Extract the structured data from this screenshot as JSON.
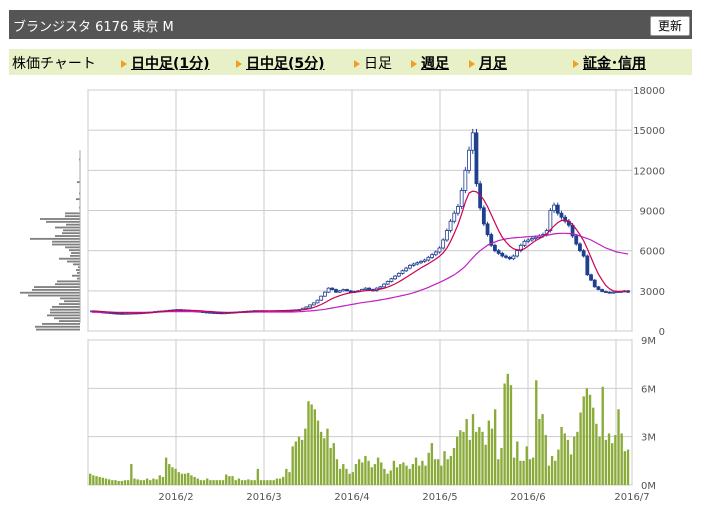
{
  "header": {
    "title": "ブランジスタ  6176  東京 M",
    "refresh_label": "更新"
  },
  "tabs": [
    {
      "label": "株価チャート",
      "link": false
    },
    {
      "label": "日中足(1分)",
      "link": true
    },
    {
      "label": "日中足(5分)",
      "link": true
    },
    {
      "label": "日足",
      "link": false
    },
    {
      "label": "週足",
      "link": true
    },
    {
      "label": "月足",
      "link": true
    },
    {
      "label": "証金･信用",
      "link": true
    }
  ],
  "chart_data": [
    {
      "type": "candlestick",
      "ylim": [
        0,
        18000
      ],
      "yticks": [
        "18000",
        "15000",
        "12000",
        "9000",
        "6000",
        "3000",
        "0"
      ],
      "x_labels": [
        "2016/2",
        "2016/3",
        "2016/4",
        "2016/5",
        "2016/6",
        "2016/7"
      ],
      "colors": {
        "up": "#ffffff",
        "down": "#1f3f8f",
        "ma_short": "#cc0055",
        "ma_long": "#c020c0",
        "volume": "#8aab3a",
        "profile": "#808080"
      },
      "close": [
        1500,
        1450,
        1420,
        1400,
        1380,
        1350,
        1330,
        1320,
        1310,
        1320,
        1330,
        1340,
        1350,
        1360,
        1380,
        1400,
        1420,
        1450,
        1480,
        1500,
        1520,
        1550,
        1580,
        1600,
        1580,
        1550,
        1520,
        1500,
        1480,
        1450,
        1420,
        1400,
        1380,
        1370,
        1360,
        1350,
        1360,
        1380,
        1400,
        1420,
        1440,
        1460,
        1480,
        1500,
        1520,
        1520,
        1510,
        1500,
        1500,
        1510,
        1520,
        1530,
        1540,
        1550,
        1560,
        1580,
        1600,
        1700,
        1800,
        1950,
        2100,
        2300,
        2600,
        2900,
        3200,
        3100,
        2900,
        3000,
        3100,
        3000,
        2900,
        2950,
        3000,
        3100,
        3200,
        3100,
        3000,
        3200,
        3300,
        3500,
        3700,
        3900,
        4100,
        4300,
        4500,
        4700,
        4900,
        5000,
        5100,
        5200,
        5300,
        5500,
        5700,
        5900,
        6200,
        6800,
        7500,
        8200,
        8800,
        9300,
        10500,
        12000,
        13500,
        14800,
        11000,
        9200,
        8000,
        7200,
        6400,
        6000,
        5800,
        5600,
        5500,
        5400,
        5600,
        6000,
        6400,
        6700,
        6800,
        6900,
        7000,
        7100,
        7200,
        7500,
        9000,
        9400,
        8800,
        8500,
        8200,
        7900,
        7100,
        6500,
        6000,
        5600,
        4200,
        3800,
        3300,
        3100,
        2950,
        2900,
        2850,
        2900,
        2950,
        2950,
        3000,
        2900
      ],
      "ma_short": [
        1500,
        1490,
        1470,
        1450,
        1430,
        1410,
        1390,
        1370,
        1360,
        1350,
        1345,
        1340,
        1340,
        1345,
        1355,
        1370,
        1385,
        1405,
        1425,
        1450,
        1475,
        1500,
        1525,
        1545,
        1555,
        1555,
        1550,
        1540,
        1530,
        1515,
        1495,
        1475,
        1455,
        1435,
        1415,
        1395,
        1385,
        1378,
        1378,
        1385,
        1395,
        1410,
        1425,
        1440,
        1460,
        1478,
        1492,
        1500,
        1505,
        1508,
        1512,
        1515,
        1518,
        1522,
        1528,
        1538,
        1550,
        1580,
        1620,
        1680,
        1760,
        1860,
        1980,
        2120,
        2280,
        2420,
        2540,
        2640,
        2730,
        2800,
        2850,
        2900,
        2940,
        2980,
        3010,
        3030,
        3050,
        3080,
        3120,
        3190,
        3280,
        3390,
        3520,
        3670,
        3830,
        4000,
        4180,
        4360,
        4540,
        4710,
        4870,
        5030,
        5200,
        5380,
        5580,
        5840,
        6200,
        6700,
        7300,
        7950,
        8750,
        9650,
        10300,
        10450,
        10400,
        10150,
        9800,
        9300,
        8700,
        8100,
        7500,
        7000,
        6650,
        6350,
        6150,
        6050,
        6050,
        6150,
        6350,
        6550,
        6750,
        6900,
        7050,
        7250,
        7550,
        7850,
        8100,
        8250,
        8300,
        8200,
        7950,
        7600,
        7200,
        6750,
        6150,
        5500,
        4850,
        4250,
        3800,
        3400,
        3150,
        3000,
        2950,
        2950,
        2950,
        2950
      ],
      "ma_long": [
        1400,
        1400,
        1400,
        1400,
        1400,
        1400,
        1400,
        1400,
        1400,
        1400,
        1400,
        1400,
        1400,
        1400,
        1400,
        1400,
        1400,
        1410,
        1420,
        1430,
        1440,
        1450,
        1450,
        1450,
        1450,
        1450,
        1450,
        1450,
        1450,
        1450,
        1450,
        1440,
        1430,
        1420,
        1410,
        1400,
        1400,
        1400,
        1400,
        1400,
        1400,
        1400,
        1400,
        1410,
        1420,
        1420,
        1420,
        1420,
        1420,
        1420,
        1420,
        1420,
        1420,
        1420,
        1420,
        1430,
        1440,
        1460,
        1480,
        1500,
        1520,
        1550,
        1580,
        1620,
        1670,
        1720,
        1770,
        1820,
        1870,
        1920,
        1970,
        2020,
        2070,
        2110,
        2150,
        2190,
        2230,
        2270,
        2320,
        2370,
        2420,
        2470,
        2530,
        2590,
        2650,
        2710,
        2780,
        2860,
        2950,
        3050,
        3150,
        3260,
        3380,
        3500,
        3630,
        3760,
        3900,
        4050,
        4200,
        4400,
        4600,
        4850,
        5150,
        5450,
        5750,
        6000,
        6200,
        6400,
        6550,
        6650,
        6750,
        6820,
        6880,
        6920,
        6950,
        6980,
        7000,
        7020,
        7040,
        7060,
        7080,
        7100,
        7120,
        7150,
        7200,
        7250,
        7280,
        7300,
        7300,
        7280,
        7250,
        7200,
        7100,
        7000,
        6900,
        6800,
        6650,
        6500,
        6350,
        6200,
        6100,
        6000,
        5900,
        5850,
        5800,
        5750
      ],
      "profile": [
        0,
        0,
        0,
        0,
        0,
        0,
        0,
        0,
        0,
        0,
        0,
        0,
        0,
        0,
        0,
        0,
        0,
        0,
        0,
        0,
        0,
        0,
        0,
        0,
        1,
        0,
        0,
        0,
        0,
        0,
        0,
        0,
        3,
        0,
        0,
        0,
        1,
        0,
        4,
        0,
        0,
        1,
        0,
        15,
        15,
        40,
        34,
        14,
        25,
        17,
        18,
        25,
        50,
        28,
        28,
        15,
        11,
        9,
        10,
        21,
        13,
        7,
        2,
        4,
        3,
        8,
        3,
        23,
        25,
        46,
        48,
        60,
        52,
        20,
        16,
        21,
        28,
        30,
        30,
        33,
        26,
        21,
        38,
        45,
        44
      ]
    },
    {
      "type": "bar",
      "ylim": [
        0,
        9000000
      ],
      "yticks": [
        "9M",
        "6M",
        "3M",
        "0M"
      ],
      "values": [
        700000,
        600000,
        550000,
        500000,
        450000,
        400000,
        350000,
        300000,
        300000,
        250000,
        250000,
        300000,
        300000,
        1300000,
        400000,
        350000,
        300000,
        300000,
        400000,
        300000,
        400000,
        350000,
        600000,
        500000,
        1700000,
        1300000,
        1100000,
        1000000,
        800000,
        700000,
        700000,
        750000,
        600000,
        500000,
        400000,
        300000,
        300000,
        400000,
        300000,
        300000,
        300000,
        300000,
        300000,
        650000,
        550000,
        550000,
        300000,
        400000,
        300000,
        300000,
        350000,
        300000,
        300000,
        1000000,
        300000,
        300000,
        300000,
        300000,
        300000,
        400000,
        400000,
        500000,
        1000000,
        800000,
        2400000,
        2700000,
        3000000,
        2800000,
        3500000,
        5200000,
        5000000,
        4700000,
        4000000,
        3300000,
        2900000,
        3500000,
        2300000,
        2600000,
        1600000,
        1000000,
        1300000,
        1000000,
        700000,
        800000,
        1300000,
        1600000,
        1400000,
        1800000,
        1500000,
        1100000,
        1300000,
        1700000,
        1400000,
        1000000,
        700000,
        900000,
        1500000,
        1100000,
        1300000,
        1400000,
        1200000,
        1000000,
        1300000,
        1700000,
        1200000,
        1500000,
        1200000,
        2000000,
        2600000,
        1600000,
        1600000,
        1200000,
        2100000,
        1600000,
        1800000,
        2300000,
        3000000,
        3400000,
        3300000,
        4100000,
        2800000,
        4400000,
        3300000,
        3600000,
        3300000,
        2500000,
        4000000,
        3500000,
        4700000,
        1600000,
        2300000,
        6300000,
        6900000,
        6200000,
        1700000,
        2700000,
        1500000,
        1500000,
        2400000,
        1600000,
        1700000,
        6500000,
        4100000,
        4400000,
        3100000,
        1200000,
        1800000,
        1500000,
        2200000,
        3600000,
        3200000,
        2800000,
        1900000,
        3000000,
        3300000,
        4500000,
        5500000,
        6000000,
        5600000,
        4800000,
        3800000,
        3000000,
        6100000,
        2800000,
        3200000,
        2600000,
        3100000,
        4700000,
        3200000,
        2100000,
        2200000
      ]
    }
  ]
}
